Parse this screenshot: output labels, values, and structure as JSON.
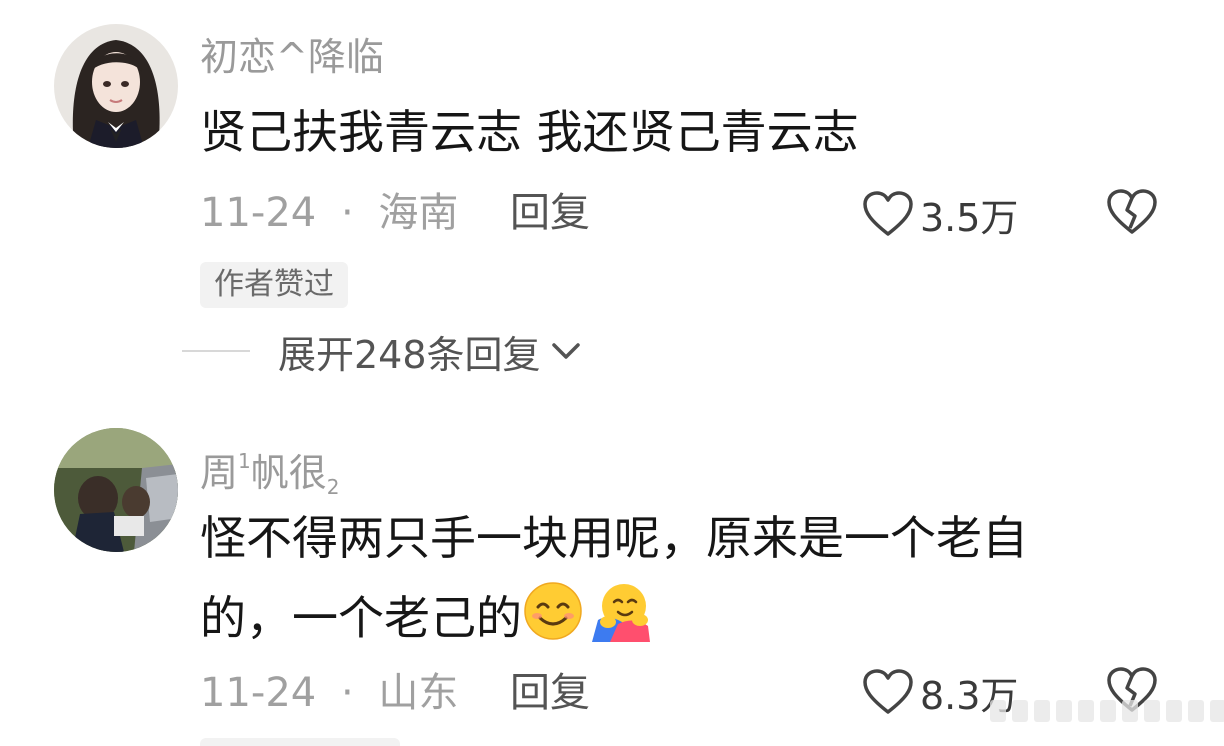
{
  "comments": [
    {
      "username": "初恋^降临",
      "text": "贤己扶我青云志 我还贤己青云志",
      "date": "11-24",
      "separator": "·",
      "location": "海南",
      "reply_label": "回复",
      "likes": "3.5万",
      "badge": "作者赞过",
      "expand_label": "展开248条回复"
    },
    {
      "username_main": "周",
      "username_sup": "1",
      "username_mid": "帆很",
      "username_sub": "2",
      "text_line1": "怪不得两只手一块用呢，原来是一个老自",
      "text_line2": "的，一个老己的",
      "date": "11-24",
      "separator": "·",
      "location": "山东",
      "reply_label": "回复",
      "likes": "8.3万"
    }
  ],
  "icons": {
    "like": "heart-outline-icon",
    "dislike": "broken-heart-icon",
    "expand": "chevron-down-icon",
    "emoji1": "smiling-face-emoji",
    "emoji2": "hugging-face-emoji"
  },
  "colors": {
    "username": "#9a9a9a",
    "text": "#161616",
    "meta": "#a0a0a0",
    "badge_bg": "#f2f2f2"
  }
}
